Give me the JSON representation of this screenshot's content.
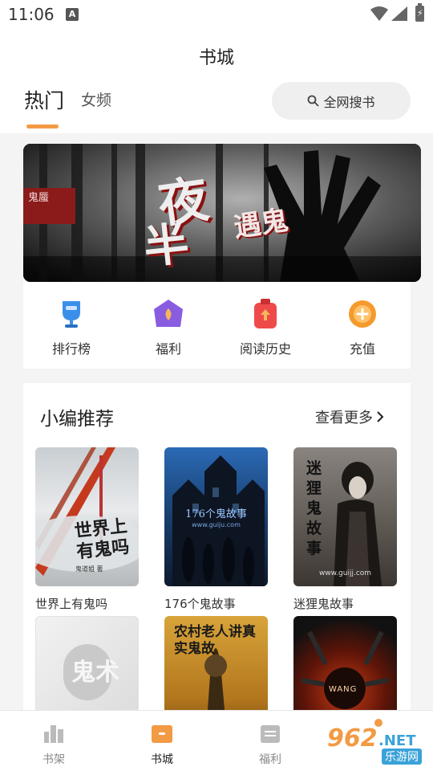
{
  "status_bar": {
    "time": "11:06",
    "notification_glyph": "A"
  },
  "header": {
    "title": "书城",
    "tabs": [
      {
        "label": "热门",
        "active": true
      },
      {
        "label": "女频",
        "active": false
      }
    ],
    "search_label": "全网搜书"
  },
  "banner": {
    "title_big1": "夜",
    "title_big2": "半",
    "title_small": "遇鬼",
    "tag": "鬼蜃"
  },
  "quick_nav": [
    {
      "label": "排行榜",
      "icon": "trophy-icon",
      "color": "#3b8fe8"
    },
    {
      "label": "福利",
      "icon": "gift-icon",
      "color": "#8a5ce0"
    },
    {
      "label": "阅读历史",
      "icon": "history-icon",
      "color": "#ef4a4a"
    },
    {
      "label": "充值",
      "icon": "coin-icon",
      "color": "#f59a2c"
    }
  ],
  "recommend": {
    "title": "小编推荐",
    "more_label": "查看更多",
    "books": [
      {
        "title": "世界上有鬼吗",
        "cover_text": "世界上有鬼吗",
        "cover_author": "鬼道姐 著"
      },
      {
        "title": "176个鬼故事",
        "cover_text": "176个鬼故事",
        "cover_url": "www.guiju.com"
      },
      {
        "title": "迷狸鬼故事",
        "cover_text": "迷狸鬼故事",
        "cover_url": "www.guijj.com"
      },
      {
        "title": "",
        "cover_text": "鬼术"
      },
      {
        "title": "",
        "cover_text": "农村老人讲真实鬼故"
      },
      {
        "title": "",
        "cover_text": "WANG"
      }
    ]
  },
  "bottom_nav": [
    {
      "label": "书架",
      "icon": "bookshelf-icon",
      "active": false
    },
    {
      "label": "书城",
      "icon": "bookstore-icon",
      "active": true
    },
    {
      "label": "福利",
      "icon": "welfare-icon",
      "active": false
    }
  ],
  "watermark": {
    "number": "962",
    "suffix": ".NET",
    "site": "乐游网"
  },
  "colors": {
    "accent": "#f39a45",
    "background": "#f4f4f4"
  }
}
